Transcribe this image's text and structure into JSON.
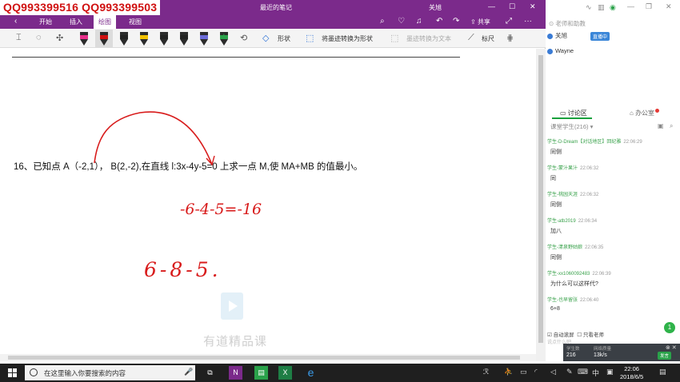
{
  "window": {
    "title": "最近的笔记",
    "user": "关旭",
    "watermark": "QQ993399516  QQ993399503"
  },
  "ribbon": {
    "tabs": [
      "开始",
      "插入",
      "绘图",
      "视图"
    ],
    "active_tab": "绘图",
    "share_label": "共享"
  },
  "toolbar": {
    "shapes_label": "形状",
    "ink_to_shape_label": "将墨迹转换为形状",
    "ink_to_text_label": "墨迹转换为文本",
    "ruler_label": "标尺",
    "pen_colors": [
      "#e8308a",
      "#d01010",
      "#222222",
      "#f2c200",
      "#222222",
      "#222222",
      "#6b6bd8",
      "#2aa24a"
    ]
  },
  "note": {
    "question": "16、已知点 A（-2,1）， B(2,-2),在直线 l:3x-4y-5=0 上求一点 M,使 MA+MB 的值最小。",
    "handwriting_1": "-6-4-5=-16",
    "handwriting_2": "6-8-5.",
    "ink_color": "#d81b1b",
    "brand_watermark": "有道精品课"
  },
  "panel": {
    "teachers_header": "老师和助教",
    "teachers": [
      {
        "name": "关旭",
        "badge": "直播中"
      },
      {
        "name": "Wayne",
        "badge": ""
      }
    ],
    "tab_discussion": "讨论区",
    "tab_office": "办公室",
    "filter_label": "课堂学生(216)",
    "messages": [
      {
        "who": "学生-D-Dream【对话地区】回纪雅",
        "time": "22:06:29",
        "text": "同侧"
      },
      {
        "who": "学生-蒙汁果汁",
        "time": "22:06:32",
        "text": "同"
      },
      {
        "who": "学生-桃园天涯",
        "time": "22:06:32",
        "text": "同侧"
      },
      {
        "who": "学生-atb2019",
        "time": "22:06:34",
        "text": "加八"
      },
      {
        "who": "学生-漾泉野姑娘",
        "time": "22:06:35",
        "text": "同侧"
      },
      {
        "who": "学生-xx1060092483",
        "time": "22:06:39",
        "text": "为什么可以这样代?"
      },
      {
        "who": "学生-也早留张",
        "time": "22:06:40",
        "text": "6+8"
      }
    ],
    "auto_scroll_label": "自动滚屏",
    "only_teacher_label": "只看老师",
    "input_hint": "说点什么吧",
    "fab_count": "1",
    "stats": {
      "students_label": "学生数",
      "students_value": "216",
      "speed_label": "网络质量",
      "speed_value": "13k/s",
      "pill_label": "发言"
    }
  },
  "taskbar": {
    "search_placeholder": "在这里输入你要搜索的内容",
    "ime": "中",
    "time": "22:06",
    "date": "2018/6/5",
    "notify_count": "1"
  }
}
